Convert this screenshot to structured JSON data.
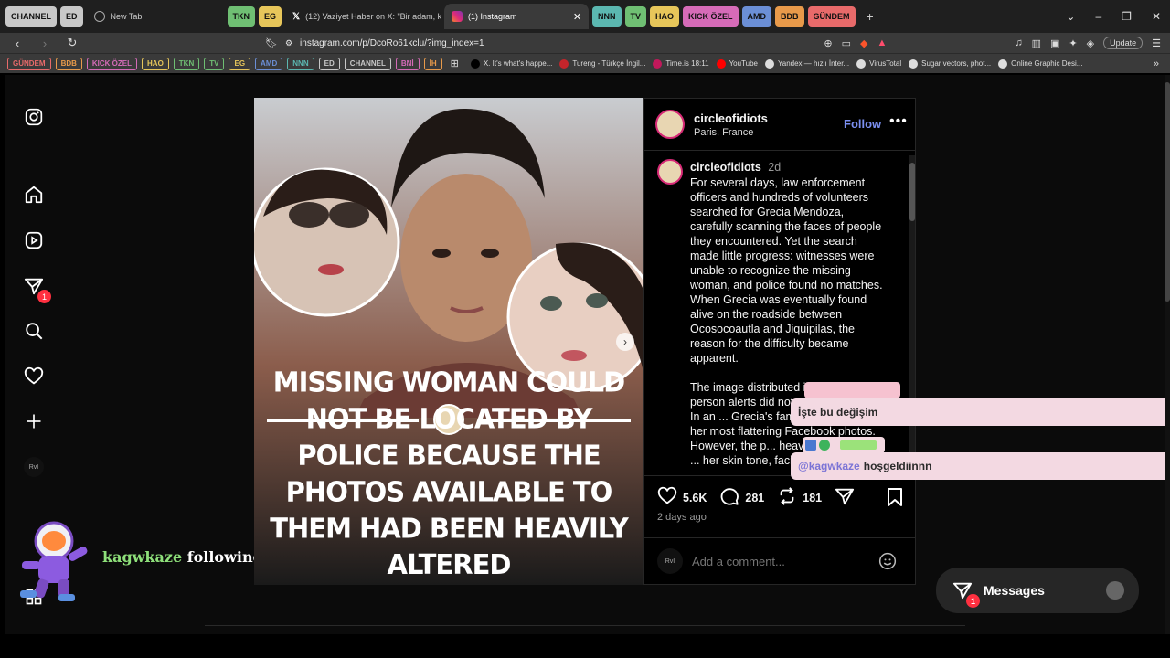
{
  "browser": {
    "tab_groups_left": [
      {
        "label": "CHANNEL",
        "color": "#c8c8c8"
      },
      {
        "label": "ED",
        "color": "#c8c8c8"
      }
    ],
    "tabs": [
      {
        "title": "New Tab",
        "active": false
      },
      {
        "title": "(12) Vaziyet Haber on X: \"Bir adam, k",
        "active": false
      },
      {
        "title": "(1) Instagram",
        "active": true
      }
    ],
    "tab_groups_mid": [
      {
        "label": "TKN",
        "color": "#6fbf73"
      },
      {
        "label": "EG",
        "color": "#e7c65a"
      }
    ],
    "tab_groups_right": [
      {
        "label": "NNN",
        "color": "#5bb7b0"
      },
      {
        "label": "TV",
        "color": "#6fbf73"
      },
      {
        "label": "HAO",
        "color": "#e7c65a"
      },
      {
        "label": "KICK ÖZEL",
        "color": "#d66bb8"
      },
      {
        "label": "AMD",
        "color": "#6b8fd6"
      },
      {
        "label": "BDB",
        "color": "#e89a4a"
      },
      {
        "label": "GÜNDEM",
        "color": "#e86a6a"
      }
    ],
    "new_tab_symbol": "+",
    "url": "instagram.com/p/DcoRo61kclu/?img_index=1",
    "update_label": "Update",
    "bookmarks_chips": [
      {
        "label": "GÜNDEM",
        "color": "#e86a6a"
      },
      {
        "label": "BDB",
        "color": "#e89a4a"
      },
      {
        "label": "KICK ÖZEL",
        "color": "#d66bb8"
      },
      {
        "label": "HAO",
        "color": "#e7c65a"
      },
      {
        "label": "TKN",
        "color": "#6fbf73"
      },
      {
        "label": "TV",
        "color": "#6fbf73"
      },
      {
        "label": "EG",
        "color": "#e7c65a"
      },
      {
        "label": "AMD",
        "color": "#6b8fd6"
      },
      {
        "label": "NNN",
        "color": "#5bb7b0"
      },
      {
        "label": "ED",
        "color": "#c8c8c8"
      },
      {
        "label": "CHANNEL",
        "color": "#c8c8c8"
      },
      {
        "label": "BNİ",
        "color": "#d66bb8"
      },
      {
        "label": "İH",
        "color": "#e89a4a"
      }
    ],
    "bookmarks_links": [
      {
        "label": "X. It's what's happe...",
        "color": "#000000"
      },
      {
        "label": "Tureng - Türkçe İngil...",
        "color": "#c4252b"
      },
      {
        "label": "Time.is 18:11",
        "color": "#c2185b"
      },
      {
        "label": "YouTube",
        "color": "#ff0000"
      },
      {
        "label": "Yandex — hızlı İnter...",
        "color": "#dddddd"
      },
      {
        "label": "VirusTotal",
        "color": "#dddddd"
      },
      {
        "label": "Sugar vectors, phot...",
        "color": "#dddddd"
      },
      {
        "label": "Online Graphic Desi...",
        "color": "#dddddd"
      }
    ]
  },
  "sidebar": {
    "notifications_badge": "1",
    "avatar_text": "RvI"
  },
  "post": {
    "headline": "MISSING WOMAN COULD NOT BE LOCATED BY POLICE BECAUSE THE PHOTOS AVAILABLE TO THEM HAD BEEN HEAVILY ALTERED",
    "author": "circleofidiots",
    "location": "Paris, France",
    "follow_label": "Follow",
    "caption_author": "circleofidiots",
    "caption_time": "2d",
    "caption_p1": "For several days, law enforcement officers and hundreds of volunteers searched for Grecia Mendoza, carefully scanning the faces of people they encountered. Yet the search made little progress: witnesses were unable to recognize the missing woman, and police found no matches. When Grecia was eventually found alive on the roadside between Ocosocoautla and Jiquipilas, the reason for the difficulty became apparent.",
    "caption_p2": "The image distributed in the missing-person alerts did not a... represent her. In an ... Grecia's family had ... some of her most flattering Facebook photos. However, the p... heavily altered with ... her skin tone, facial",
    "likes": "5.6K",
    "comments": "281",
    "reposts": "181",
    "time_ago": "2 days ago",
    "add_comment_placeholder": "Add a comment..."
  },
  "stream_overlay": {
    "follow_user": "kagwkaze",
    "follow_text": "following!",
    "chat_line1": "İşte bu değişim",
    "chat_line2_user": "@kagwkaze",
    "chat_line2_text": "hoşgeldiinnn"
  },
  "messages": {
    "label": "Messages",
    "badge": "1"
  }
}
